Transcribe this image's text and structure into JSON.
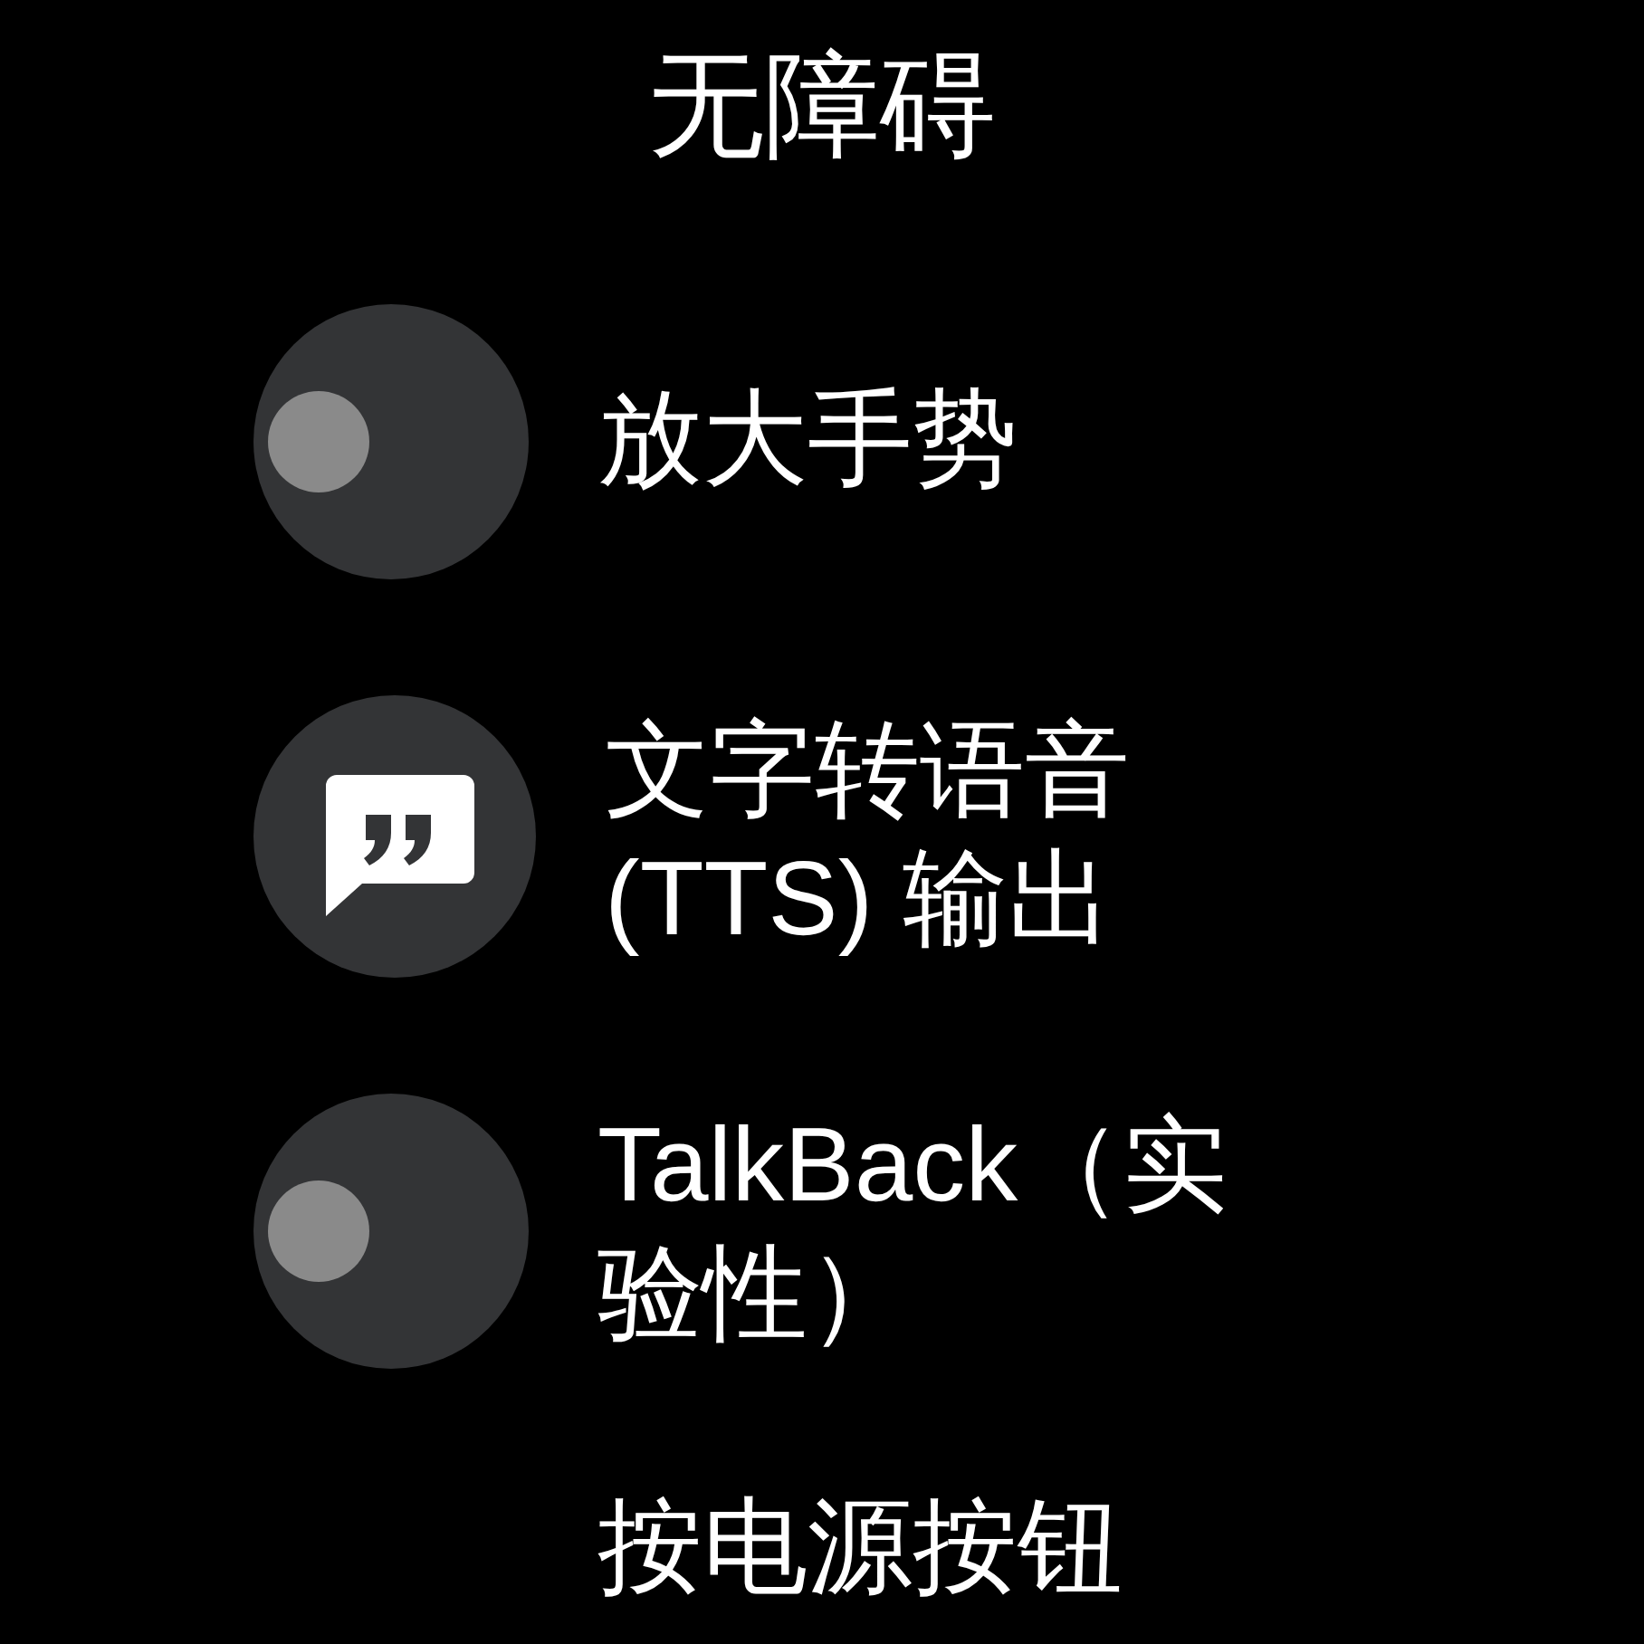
{
  "title": "无障碍",
  "items": [
    {
      "kind": "toggle",
      "label": "放大手势",
      "on": false
    },
    {
      "kind": "icon",
      "label": "文字转语音 (TTS) 输出"
    },
    {
      "kind": "toggle",
      "label": "TalkBack（实验性）",
      "on": false
    },
    {
      "kind": "plain",
      "label": "按电源按钮"
    }
  ]
}
